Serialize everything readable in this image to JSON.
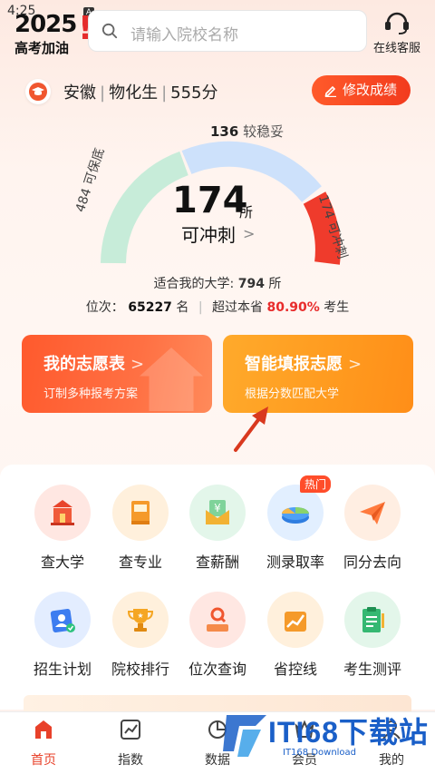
{
  "status": {
    "time": "4:25",
    "badge": "A"
  },
  "logo": {
    "year": "2025",
    "bang": "!",
    "slogan": "高考加油"
  },
  "search": {
    "placeholder": "请输入院校名称"
  },
  "service": {
    "label": "在线客服"
  },
  "profile": {
    "province": "安徽",
    "subjects": "物化生",
    "score": "555分",
    "edit_label": "修改成绩"
  },
  "gauge": {
    "count": "174",
    "unit": "所",
    "label": "可冲刺",
    "top_count": "136",
    "top_label": "较稳妥",
    "left_label": "484 可保底",
    "right_label": "174 可冲刺",
    "safe": 484,
    "stable": 136,
    "reach": 174
  },
  "summary": {
    "suitable_label": "适合我的大学:",
    "suitable_count": "794",
    "suitable_unit": "所",
    "rank_label": "位次：",
    "rank_value": "65227",
    "rank_unit": "名",
    "beat_label": "超过本省",
    "beat_value": "80.90%",
    "beat_unit": "考生"
  },
  "cards": [
    {
      "title": "我的志愿表",
      "sub": "订制多种报考方案",
      "arrow": ">"
    },
    {
      "title": "智能填报志愿",
      "sub": "根据分数匹配大学",
      "arrow": ">"
    }
  ],
  "features": [
    {
      "label": "查大学",
      "icon": "university-icon"
    },
    {
      "label": "查专业",
      "icon": "book-icon"
    },
    {
      "label": "查薪酬",
      "icon": "salary-envelope-icon"
    },
    {
      "label": "测录取率",
      "icon": "pie-chart-icon",
      "badge": "热门"
    },
    {
      "label": "同分去向",
      "icon": "paper-plane-icon"
    },
    {
      "label": "招生计划",
      "icon": "student-card-icon"
    },
    {
      "label": "院校排行",
      "icon": "trophy-icon"
    },
    {
      "label": "位次查询",
      "icon": "search-rank-icon"
    },
    {
      "label": "省控线",
      "icon": "line-chart-icon"
    },
    {
      "label": "考生测评",
      "icon": "clipboard-icon"
    }
  ],
  "nav": [
    {
      "label": "首页",
      "icon": "home-icon"
    },
    {
      "label": "指数",
      "icon": "index-chart-icon"
    },
    {
      "label": "数据",
      "icon": "data-icon"
    },
    {
      "label": "会员",
      "icon": "vip-icon"
    },
    {
      "label": "我的",
      "icon": "user-icon"
    }
  ],
  "watermark": {
    "text": "ITI68下载站",
    "sub": "IT168 Download"
  },
  "colors": {
    "accent": "#f23b1e",
    "orange": "#ff9a1f",
    "green_arc": "#bfe9d4",
    "blue_arc": "#cfe2fb",
    "red_arc": "#ef3b2c"
  }
}
